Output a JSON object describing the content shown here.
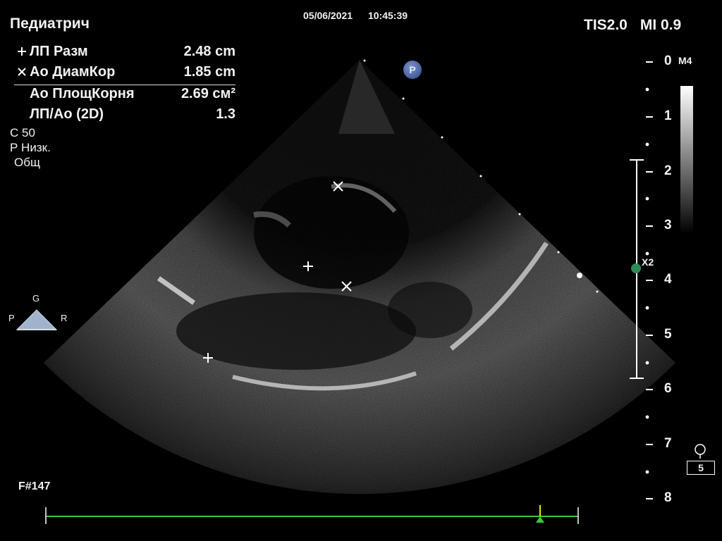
{
  "header": {
    "preset": "Педиатрич",
    "date": "05/06/2021",
    "time": "10:45:39",
    "tis": "TIS2.0",
    "mi": "MI 0.9"
  },
  "measurements": [
    {
      "label": "ЛП Разм",
      "value": "2.48 cm",
      "marker": "plus"
    },
    {
      "label": "Ао ДиамКор",
      "value": "1.85 cm",
      "marker": "x"
    },
    {
      "label": "Ао ПлощКорня",
      "value": "2.69 см²",
      "marker": "none"
    },
    {
      "label": "ЛП/Ао (2D)",
      "value": "1.3",
      "marker": "none"
    }
  ],
  "params": [
    "С 50",
    "Р Низк.",
    "Общ"
  ],
  "frame_count": "F#147",
  "depth_scale": [
    "0",
    "1",
    "2",
    "3",
    "4",
    "5",
    "6",
    "7",
    "8"
  ],
  "map_label": "M4",
  "focus_label": "X2",
  "orientation": {
    "top": "G",
    "left": "P",
    "right": "R"
  },
  "probe_badge": "P",
  "cine_box": "5",
  "colors": {
    "accent_green": "#33cc33",
    "focus_marker": "#2e8b57",
    "cine_marker": "#e8e800"
  }
}
